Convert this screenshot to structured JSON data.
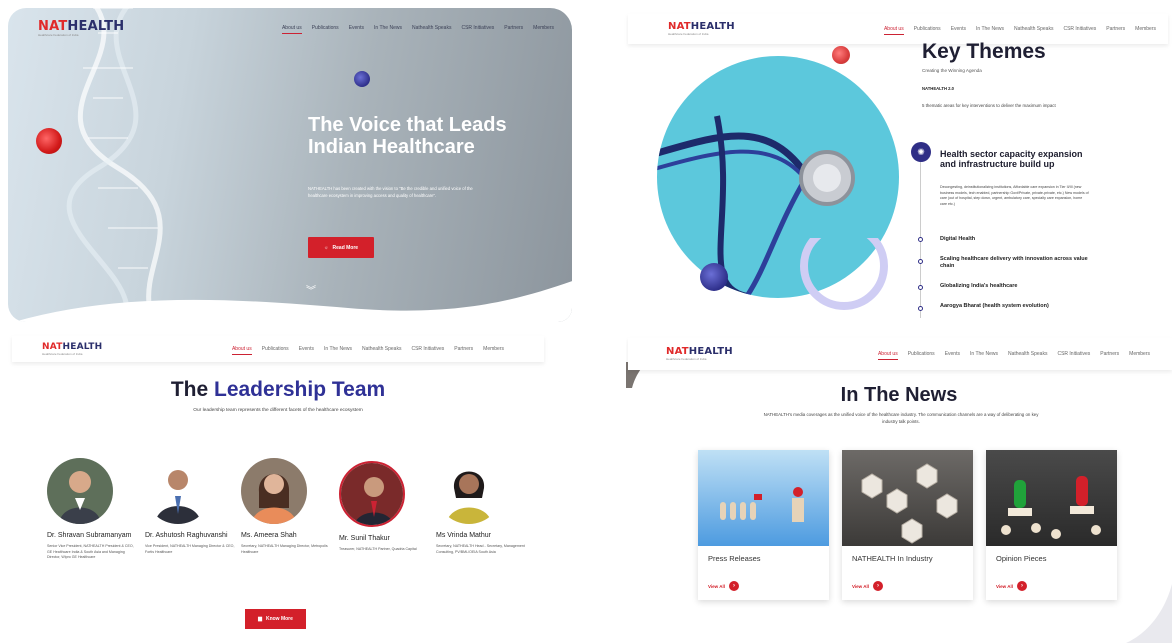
{
  "brand": {
    "nat": "NAT",
    "health": "HEALTH",
    "tagline": "Healthcare Federation of India"
  },
  "nav": [
    "About us",
    "Publications",
    "Events",
    "In The News",
    "Nathealth Speaks",
    "CSR Initiatives",
    "Partners",
    "Members"
  ],
  "hero": {
    "title": "The Voice that Leads Indian Healthcare",
    "body": "NATHEALTH has been created with the vision to \"Be the credible and unified voice of the healthcare ecosystem in improving access and quality of healthcare\".",
    "button": "Read More"
  },
  "key_themes": {
    "title": "Key Themes",
    "subtitle": "Creating the Winning Agenda",
    "version": "NATHEALTH 2.0",
    "body": "5 thematic areas for key interventions to deliver the maximum impact",
    "main_item": "Health sector capacity expansion and infrastructure build up",
    "main_body": "Decongesting, deinstitutionalizing institutions, Affordable care expansion in Tier II/III (new business models, tech enabled, partnership Govt/Private, private-private, etc.) New models of care (out of hospital, step down, urgent, ambulatory care, specialty care expansion, home care etc.)",
    "items": [
      "Digital Health",
      "Scaling healthcare delivery with innovation across value chain",
      "Globalizing India's healthcare",
      "Aarogya Bharat (health system evolution)"
    ]
  },
  "leadership": {
    "title_a": "The ",
    "title_b": "Leadership Team",
    "subtitle": "Our leadership team represents the different facets of the healthcare ecosystem",
    "members": [
      {
        "name": "Dr. Shravan Subramanyam",
        "role": "Senior Vice President, NATHEALTH President & CEO, GE Healthcare India & South Asia and Managing Director, Wipro GE Healthcare"
      },
      {
        "name": "Dr. Ashutosh Raghuvanshi",
        "role": "Vice President, NATHEALTH Managing Director & CEO, Fortis Healthcare"
      },
      {
        "name": "Ms. Ameera Shah",
        "role": "Secretary, NATHEALTH Managing Director, Metropolis Healthcare"
      },
      {
        "name": "Mr. Sunil Thakur",
        "role": "Treasurer, NATHEALTH Partner, Quadria Capital"
      },
      {
        "name": "Ms Vrinda Mathur",
        "role": "Secretary, NATHEALTH Head - Secretary, Management Consulting, PV/BML/OEIA South Asia"
      }
    ],
    "button": "Know More"
  },
  "news": {
    "title": "In The News",
    "subtitle": "NATHEALTH's media coverages as the unified voice of the healthcare industry. The communication channels are a way of deliberating on key industry talk points.",
    "cards": [
      {
        "label": "Press Releases",
        "view": "View All"
      },
      {
        "label": "NATHEALTH In Industry",
        "view": "View All"
      },
      {
        "label": "Opinion Pieces",
        "view": "View All"
      }
    ]
  },
  "colors": {
    "brand_red": "#d3202a",
    "brand_navy": "#2b2f6b",
    "accent_purple": "#2f3196",
    "hero_teal": "#5cc8dc"
  }
}
